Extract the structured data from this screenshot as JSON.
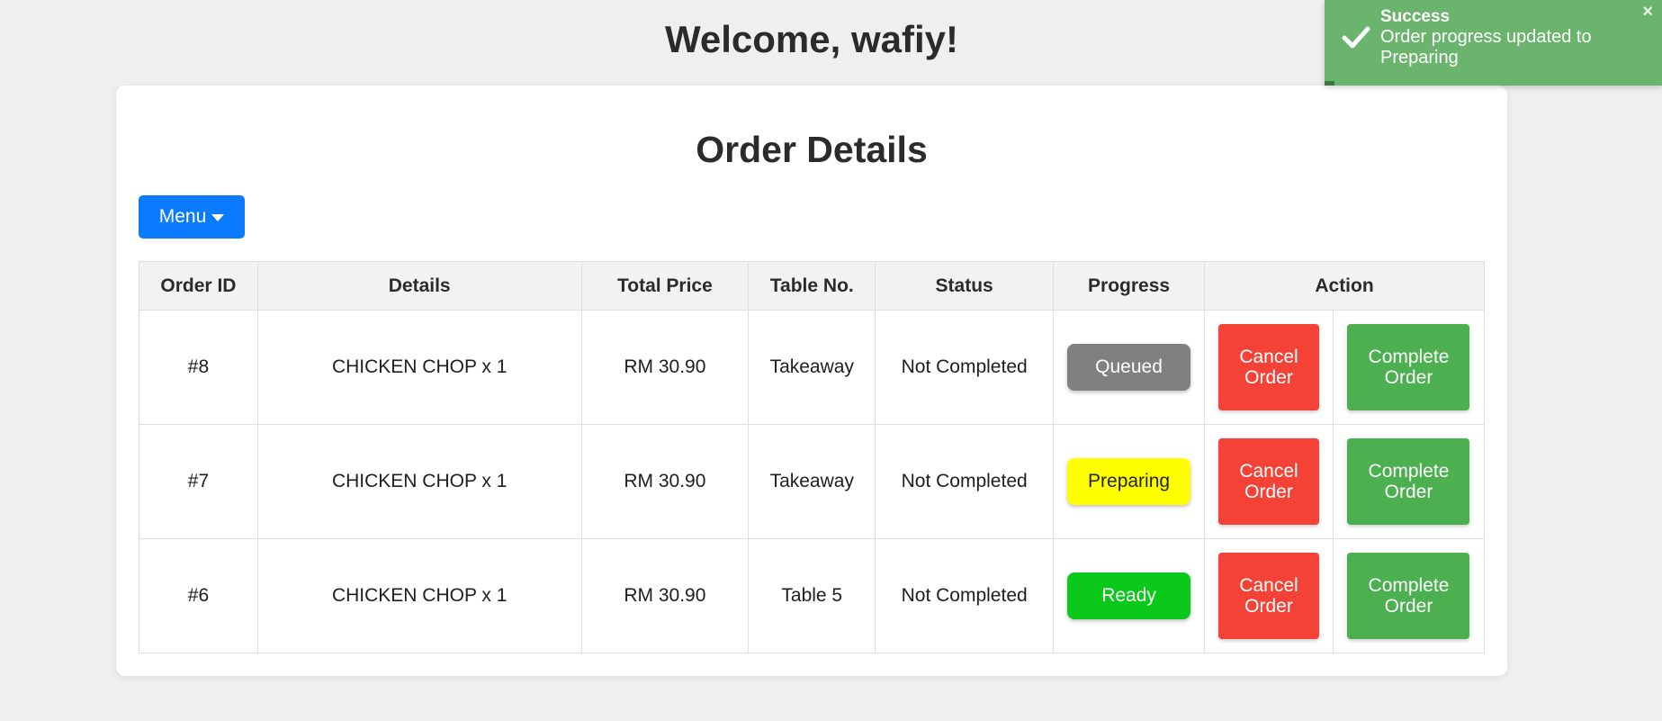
{
  "header": {
    "welcome": "Welcome, wafiy!"
  },
  "card": {
    "title": "Order Details",
    "menu_label": "Menu"
  },
  "table": {
    "headers": {
      "order_id": "Order ID",
      "details": "Details",
      "total_price": "Total Price",
      "table_no": "Table No.",
      "status": "Status",
      "progress": "Progress",
      "action": "Action"
    },
    "rows": [
      {
        "id": "#8",
        "details": "CHICKEN CHOP x 1",
        "price": "RM 30.90",
        "table": "Takeaway",
        "status": "Not Completed",
        "progress": "Queued",
        "cancel": "Cancel Order",
        "complete": "Complete Order"
      },
      {
        "id": "#7",
        "details": "CHICKEN CHOP x 1",
        "price": "RM 30.90",
        "table": "Takeaway",
        "status": "Not Completed",
        "progress": "Preparing",
        "cancel": "Cancel Order",
        "complete": "Complete Order"
      },
      {
        "id": "#6",
        "details": "CHICKEN CHOP x 1",
        "price": "RM 30.90",
        "table": "Table 5",
        "status": "Not Completed",
        "progress": "Ready",
        "cancel": "Cancel Order",
        "complete": "Complete Order"
      }
    ]
  },
  "toast": {
    "title": "Success",
    "message": "Order progress updated to Preparing",
    "close": "×",
    "remaining": 0.03
  },
  "colors": {
    "primary": "#0a7bff",
    "queued": "#808080",
    "preparing": "#ffff00",
    "ready": "#0bc91b",
    "cancel": "#f44336",
    "complete": "#4caf50",
    "toast": "#6ab46d"
  },
  "icons": {
    "toast": "check-icon",
    "menu": "caret-down-icon"
  }
}
